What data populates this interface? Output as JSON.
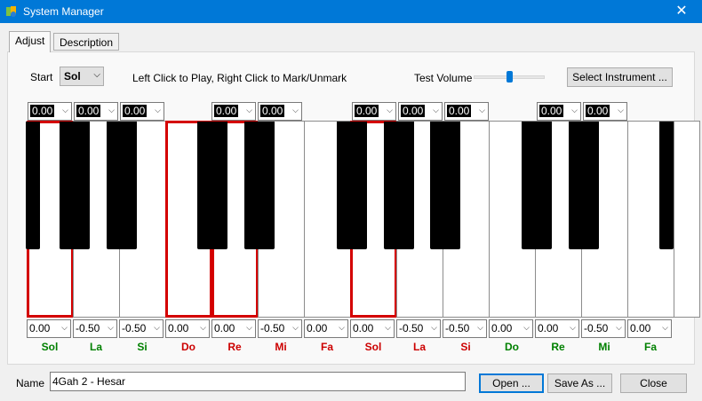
{
  "window": {
    "title": "System Manager",
    "close_glyph": "✕"
  },
  "tabs": [
    {
      "label": "Adjust",
      "active": true
    },
    {
      "label": "Description",
      "active": false
    }
  ],
  "controls": {
    "start_label": "Start",
    "start_value": "Sol",
    "instruction": "Left Click to Play,  Right Click to Mark/Unmark",
    "volume_label": "Test Volume",
    "volume_level": 0.5,
    "select_instrument": "Select Instrument ..."
  },
  "top_values": [
    "0.00",
    "0.00",
    "0.00",
    "0.00",
    "0.00",
    "0.00",
    "0.00",
    "0.00",
    "0.00",
    "0.00"
  ],
  "bottom_values": [
    "0.00",
    "-0.50",
    "-0.50",
    "0.00",
    "0.00",
    "-0.50",
    "0.00",
    "0.00",
    "-0.50",
    "-0.50",
    "0.00",
    "0.00",
    "-0.50",
    "0.00"
  ],
  "notes": [
    {
      "label": "Sol",
      "color": "#008000"
    },
    {
      "label": "La",
      "color": "#008000"
    },
    {
      "label": "Si",
      "color": "#008000"
    },
    {
      "label": "Do",
      "color": "#cc0000"
    },
    {
      "label": "Re",
      "color": "#cc0000"
    },
    {
      "label": "Mi",
      "color": "#cc0000"
    },
    {
      "label": "Fa",
      "color": "#cc0000"
    },
    {
      "label": "Sol",
      "color": "#cc0000"
    },
    {
      "label": "La",
      "color": "#cc0000"
    },
    {
      "label": "Si",
      "color": "#cc0000"
    },
    {
      "label": "Do",
      "color": "#008000"
    },
    {
      "label": "Re",
      "color": "#008000"
    },
    {
      "label": "Mi",
      "color": "#008000"
    },
    {
      "label": "Fa",
      "color": "#008000"
    }
  ],
  "marked_keys": [
    0,
    3,
    4,
    7
  ],
  "footer": {
    "name_label": "Name",
    "name_value": "4Gah 2 - Hesar",
    "open": "Open ...",
    "save_as": "Save As ...",
    "close": "Close"
  },
  "colors": {
    "accent": "#0078d7",
    "mark": "#d40000"
  },
  "icons": {
    "app": "app-icon",
    "dropdown": "chevron-down-icon"
  }
}
